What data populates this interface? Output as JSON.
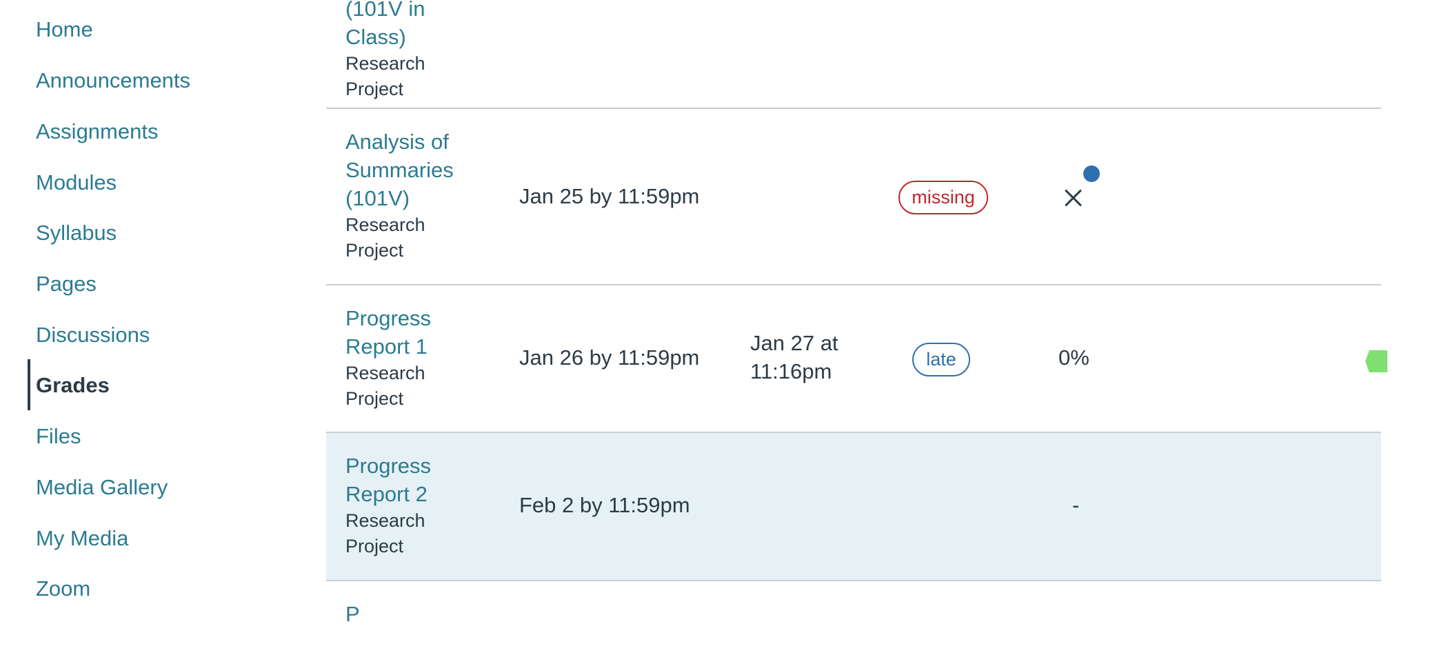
{
  "sidebar": {
    "items": [
      {
        "label": "Home"
      },
      {
        "label": "Announcements"
      },
      {
        "label": "Assignments"
      },
      {
        "label": "Modules"
      },
      {
        "label": "Syllabus"
      },
      {
        "label": "Pages"
      },
      {
        "label": "Discussions"
      },
      {
        "label": "Grades",
        "active": true
      },
      {
        "label": "Files"
      },
      {
        "label": "Media Gallery"
      },
      {
        "label": "My Media"
      },
      {
        "label": "Zoom"
      }
    ]
  },
  "grades": {
    "rows": [
      {
        "name_partial_top": "(101V in",
        "name_line2": "Class)",
        "category": "Research Project"
      },
      {
        "name": "Analysis of Summaries (101V)",
        "category": "Research Project",
        "due": "Jan 25 by 11:59pm",
        "submitted": "",
        "status": "missing",
        "score_icon": "x-icon",
        "unread": true
      },
      {
        "name": "Progress Report 1",
        "category": "Research Project",
        "due": "Jan 26 by 11:59pm",
        "submitted": "Jan 27 at 11:16pm",
        "status": "late",
        "score": "0%",
        "flag_icon": "flag-icon"
      },
      {
        "name": "Progress Report 2",
        "category": "Research Project",
        "due": "Feb 2 by 11:59pm",
        "submitted": "",
        "status": "",
        "score": "-",
        "highlighted": true
      },
      {
        "name_partial": "P"
      }
    ]
  },
  "colors": {
    "link": "#2b7b91",
    "text": "#2d3b45",
    "missing": "#c2262b",
    "late": "#2f6fb0",
    "highlight_row": "#e6f1f6",
    "flag": "#7fe06f"
  }
}
